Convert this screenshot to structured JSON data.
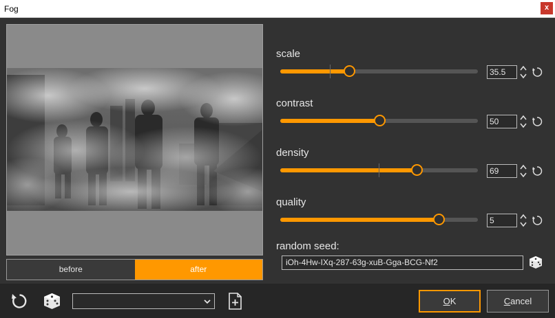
{
  "window": {
    "title": "Fog",
    "close_label": "x"
  },
  "preview": {
    "before_label": "before",
    "after_label": "after",
    "selected": "after"
  },
  "params": [
    {
      "label": "scale",
      "value": "35.5",
      "fraction": 0.35
    },
    {
      "label": "contrast",
      "value": "50",
      "fraction": 0.5
    },
    {
      "label": "density",
      "value": "69",
      "fraction": 0.69
    },
    {
      "label": "quality",
      "value": "5",
      "fraction": 0.8
    }
  ],
  "seed": {
    "label": "random seed:",
    "value": "iOh-4Hw-IXq-287-63g-xuB-Gga-BCG-Nf2"
  },
  "footer": {
    "preset_value": "",
    "ok_label": "K",
    "ok_mnemonic": "O",
    "cancel_label": "ancel",
    "cancel_mnemonic": "C"
  },
  "colors": {
    "accent": "#ff9800",
    "background": "#323232",
    "bar": "#262626"
  },
  "icons": [
    "reset-icon",
    "dice-icon",
    "chevron-down-icon",
    "new-preset-icon",
    "spin-icon"
  ]
}
